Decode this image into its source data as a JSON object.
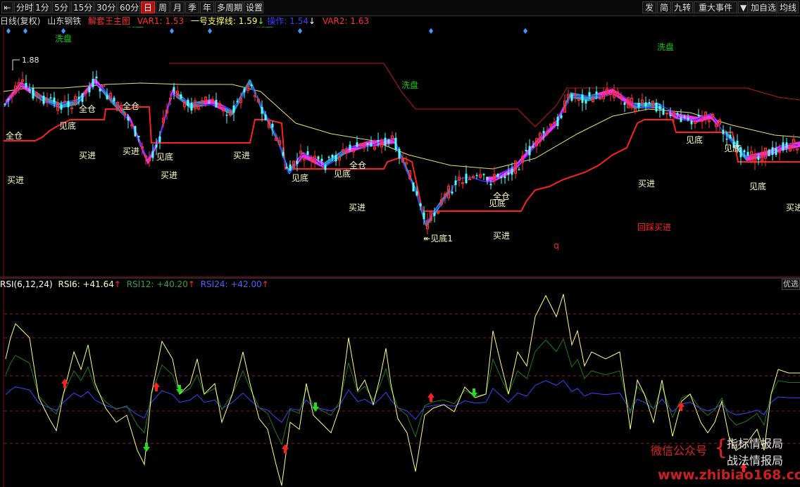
{
  "toolbar": {
    "left_buttons": [
      {
        "label": "⇤",
        "name": "back-button"
      },
      {
        "label": "分时",
        "name": "period-fenshi"
      },
      {
        "label": "1分",
        "name": "period-1min"
      },
      {
        "label": "5分",
        "name": "period-5min"
      },
      {
        "label": "15分",
        "name": "period-15min"
      },
      {
        "label": "30分",
        "name": "period-30min"
      },
      {
        "label": "60分",
        "name": "period-60min"
      },
      {
        "label": "日",
        "name": "period-day",
        "active": true
      },
      {
        "label": "周",
        "name": "period-week"
      },
      {
        "label": "月",
        "name": "period-month"
      },
      {
        "label": "季",
        "name": "period-quarter"
      },
      {
        "label": "年",
        "name": "period-year"
      },
      {
        "label": "多周期",
        "name": "period-multi"
      },
      {
        "label": "设置",
        "name": "settings-button"
      }
    ],
    "right_buttons": [
      {
        "label": "发",
        "name": "fa-button"
      },
      {
        "label": "简",
        "name": "jian-button"
      },
      {
        "label": "九转",
        "name": "jiuzhuan-button"
      },
      {
        "label": "重大事件",
        "name": "major-events-button"
      },
      {
        "label": "▼",
        "name": "events-dropdown"
      },
      {
        "label": "加自选",
        "name": "add-watchlist-button"
      },
      {
        "label": "均线",
        "name": "ma-button"
      }
    ]
  },
  "info": {
    "period": "日线(复权)",
    "stock": "山东钢铁",
    "indicator": "解套王主图",
    "var1": "VAR1: 1.53",
    "support": "一号支撑线: 1.59",
    "support_arrow": "↓",
    "op": "操作: 1.54",
    "op_arrow": "↓",
    "var2": "VAR2: 1.63"
  },
  "colors": {
    "up": "#ff3232",
    "down": "#54fcfc",
    "support": "#ff2020",
    "yellow": "#e8e070",
    "blue": "#2830ff",
    "ribbon_up": "#ff30ff",
    "ribbon_down": "#2c9ccc",
    "rsi6": "#ffff80",
    "rsi12": "#1e7a1e",
    "rsi24": "#4040ff"
  },
  "main_chart": {
    "price_high_label": "1.88",
    "y_range": [
      1.4,
      1.95
    ],
    "annotations": [
      {
        "text": "洗盘",
        "x": 157,
        "y": 25,
        "color": "#00d000"
      },
      {
        "text": "洗盘",
        "x": 192,
        "y": 33,
        "color": "#00d000"
      },
      {
        "text": "洗盘",
        "x": 90,
        "y": 54,
        "color": "#00d000"
      },
      {
        "text": "洗盘",
        "x": 376,
        "y": 33,
        "color": "#00d000"
      },
      {
        "text": "洗盘",
        "x": 582,
        "y": 120,
        "color": "#00d000"
      },
      {
        "text": "洗盘",
        "x": 945,
        "y": 66,
        "color": "#00d000"
      },
      {
        "text": "全仓",
        "x": 124,
        "y": 154,
        "color": "#ffffc0"
      },
      {
        "text": "全仓",
        "x": 186,
        "y": 150,
        "color": "#ffffc0"
      },
      {
        "text": "全仓",
        "x": 20,
        "y": 192,
        "color": "#ffffc0"
      },
      {
        "text": "全仓",
        "x": 508,
        "y": 234,
        "color": "#ffffc0"
      },
      {
        "text": "全仓",
        "x": 712,
        "y": 278,
        "color": "#ffffc0"
      },
      {
        "text": "见底",
        "x": 96,
        "y": 178,
        "color": "#ffffc0"
      },
      {
        "text": "见底",
        "x": 234,
        "y": 222,
        "color": "#ffffc0"
      },
      {
        "text": "见底",
        "x": 426,
        "y": 252,
        "color": "#ffffc0"
      },
      {
        "text": "见底",
        "x": 486,
        "y": 246,
        "color": "#ffffc0"
      },
      {
        "text": "见底",
        "x": 706,
        "y": 288,
        "color": "#ffffc0"
      },
      {
        "text": "见底",
        "x": 986,
        "y": 198,
        "color": "#ffffc0"
      },
      {
        "text": "见底",
        "x": 1040,
        "y": 210,
        "color": "#ffffc0"
      },
      {
        "text": "见底",
        "x": 1076,
        "y": 264,
        "color": "#ffffc0"
      },
      {
        "text": "↞见底1",
        "x": 622,
        "y": 338,
        "color": "#ffffc0"
      },
      {
        "text": "买进",
        "x": 124,
        "y": 220,
        "color": "#ffffc0"
      },
      {
        "text": "买进",
        "x": 186,
        "y": 214,
        "color": "#ffffc0"
      },
      {
        "text": "买进",
        "x": 22,
        "y": 255,
        "color": "#ffffc0"
      },
      {
        "text": "买进",
        "x": 240,
        "y": 248,
        "color": "#ffffc0"
      },
      {
        "text": "买进",
        "x": 343,
        "y": 220,
        "color": "#ffffc0"
      },
      {
        "text": "买进",
        "x": 507,
        "y": 294,
        "color": "#ffffc0"
      },
      {
        "text": "买进",
        "x": 712,
        "y": 334,
        "color": "#ffffc0"
      },
      {
        "text": "买进",
        "x": 918,
        "y": 260,
        "color": "#ffffc0"
      },
      {
        "text": "买进",
        "x": 1128,
        "y": 294,
        "color": "#ffffc0"
      },
      {
        "text": "回踩买进",
        "x": 929,
        "y": 322,
        "color": "#ff2020"
      },
      {
        "text": "q",
        "x": 790,
        "y": 348,
        "color": "#ff2020"
      }
    ],
    "markers_x": [
      12,
      36,
      90,
      244,
      298,
      426,
      612,
      746
    ]
  },
  "rsi": {
    "label": "RSI(6,12,24)",
    "rsi6_text": "RSI6: +41.64",
    "rsi12_text": "RSI12: +40.20",
    "rsi24_text": "RSI24: +42.00",
    "up_arrow": "↑",
    "option_label": "优选",
    "last": {
      "rsi6": 41.64,
      "rsi12": 40.2,
      "rsi24": 42.0
    }
  },
  "watermark": {
    "wechat": "微信公众号",
    "brace": "{",
    "line1": "指标情报局",
    "line2": "战法情报局",
    "site": "www.zhibiao168.com"
  }
}
